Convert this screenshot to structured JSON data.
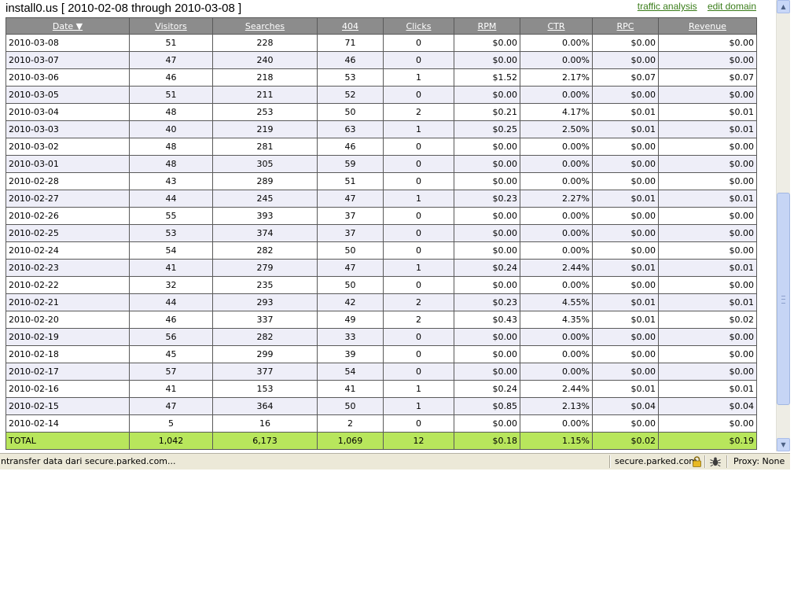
{
  "page": {
    "title": "install0.us [ 2010-02-08 through 2010-03-08 ]",
    "links": {
      "traffic_analysis": "traffic analysis",
      "edit_domain": "edit domain"
    }
  },
  "table": {
    "columns": [
      "Date ▼",
      "Visitors",
      "Searches",
      "404",
      "Clicks",
      "RPM",
      "CTR",
      "RPC",
      "Revenue"
    ],
    "rows": [
      [
        "2010-03-08",
        "51",
        "228",
        "71",
        "0",
        "$0.00",
        "0.00%",
        "$0.00",
        "$0.00"
      ],
      [
        "2010-03-07",
        "47",
        "240",
        "46",
        "0",
        "$0.00",
        "0.00%",
        "$0.00",
        "$0.00"
      ],
      [
        "2010-03-06",
        "46",
        "218",
        "53",
        "1",
        "$1.52",
        "2.17%",
        "$0.07",
        "$0.07"
      ],
      [
        "2010-03-05",
        "51",
        "211",
        "52",
        "0",
        "$0.00",
        "0.00%",
        "$0.00",
        "$0.00"
      ],
      [
        "2010-03-04",
        "48",
        "253",
        "50",
        "2",
        "$0.21",
        "4.17%",
        "$0.01",
        "$0.01"
      ],
      [
        "2010-03-03",
        "40",
        "219",
        "63",
        "1",
        "$0.25",
        "2.50%",
        "$0.01",
        "$0.01"
      ],
      [
        "2010-03-02",
        "48",
        "281",
        "46",
        "0",
        "$0.00",
        "0.00%",
        "$0.00",
        "$0.00"
      ],
      [
        "2010-03-01",
        "48",
        "305",
        "59",
        "0",
        "$0.00",
        "0.00%",
        "$0.00",
        "$0.00"
      ],
      [
        "2010-02-28",
        "43",
        "289",
        "51",
        "0",
        "$0.00",
        "0.00%",
        "$0.00",
        "$0.00"
      ],
      [
        "2010-02-27",
        "44",
        "245",
        "47",
        "1",
        "$0.23",
        "2.27%",
        "$0.01",
        "$0.01"
      ],
      [
        "2010-02-26",
        "55",
        "393",
        "37",
        "0",
        "$0.00",
        "0.00%",
        "$0.00",
        "$0.00"
      ],
      [
        "2010-02-25",
        "53",
        "374",
        "37",
        "0",
        "$0.00",
        "0.00%",
        "$0.00",
        "$0.00"
      ],
      [
        "2010-02-24",
        "54",
        "282",
        "50",
        "0",
        "$0.00",
        "0.00%",
        "$0.00",
        "$0.00"
      ],
      [
        "2010-02-23",
        "41",
        "279",
        "47",
        "1",
        "$0.24",
        "2.44%",
        "$0.01",
        "$0.01"
      ],
      [
        "2010-02-22",
        "32",
        "235",
        "50",
        "0",
        "$0.00",
        "0.00%",
        "$0.00",
        "$0.00"
      ],
      [
        "2010-02-21",
        "44",
        "293",
        "42",
        "2",
        "$0.23",
        "4.55%",
        "$0.01",
        "$0.01"
      ],
      [
        "2010-02-20",
        "46",
        "337",
        "49",
        "2",
        "$0.43",
        "4.35%",
        "$0.01",
        "$0.02"
      ],
      [
        "2010-02-19",
        "56",
        "282",
        "33",
        "0",
        "$0.00",
        "0.00%",
        "$0.00",
        "$0.00"
      ],
      [
        "2010-02-18",
        "45",
        "299",
        "39",
        "0",
        "$0.00",
        "0.00%",
        "$0.00",
        "$0.00"
      ],
      [
        "2010-02-17",
        "57",
        "377",
        "54",
        "0",
        "$0.00",
        "0.00%",
        "$0.00",
        "$0.00"
      ],
      [
        "2010-02-16",
        "41",
        "153",
        "41",
        "1",
        "$0.24",
        "2.44%",
        "$0.01",
        "$0.01"
      ],
      [
        "2010-02-15",
        "47",
        "364",
        "50",
        "1",
        "$0.85",
        "2.13%",
        "$0.04",
        "$0.04"
      ],
      [
        "2010-02-14",
        "5",
        "16",
        "2",
        "0",
        "$0.00",
        "0.00%",
        "$0.00",
        "$0.00"
      ]
    ],
    "total": [
      "TOTAL",
      "1,042",
      "6,173",
      "1,069",
      "12",
      "$0.18",
      "1.15%",
      "$0.02",
      "$0.19"
    ]
  },
  "status_bar": {
    "message": "ntransfer data dari secure.parked.com...",
    "host": "secure.parked.com",
    "proxy": "Proxy: None"
  },
  "icons": {
    "lock": "lock-icon",
    "bug": "bug-icon",
    "scroll_up": "scroll-up-arrow-icon",
    "scroll_down": "scroll-down-arrow-icon"
  },
  "colors": {
    "header_bg": "#8c8c8c",
    "alt_row_bg": "#eeeef8",
    "total_row_bg": "#b8e65c",
    "link_green": "#3a7d1a"
  }
}
